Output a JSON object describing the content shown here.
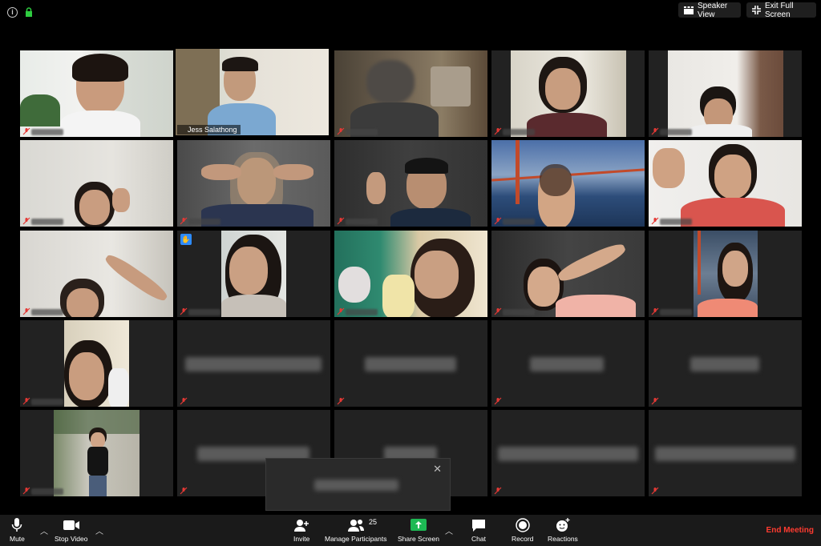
{
  "topbar": {
    "speaker_view_label": "Speaker View",
    "exit_fullscreen_label": "Exit Full Screen"
  },
  "participants": {
    "active_speaker_name": "Jess Salathong"
  },
  "toolbar": {
    "mute_label": "Mute",
    "stop_video_label": "Stop Video",
    "invite_label": "Invite",
    "manage_participants_label": "Manage Participants",
    "participant_count": "25",
    "share_screen_label": "Share Screen",
    "chat_label": "Chat",
    "record_label": "Record",
    "reactions_label": "Reactions",
    "end_meeting_label": "End Meeting"
  },
  "colors": {
    "active_speaker_border": "#d9e26d",
    "share_screen_green": "#1db954",
    "end_meeting_red": "#ff3b30",
    "raise_hand_blue": "#2d8cff"
  },
  "icons": [
    "info-icon",
    "lock-icon",
    "speaker-view-icon",
    "exit-fullscreen-icon",
    "mic-off-icon",
    "raise-hand-icon",
    "microphone-icon",
    "video-camera-icon",
    "invite-icon",
    "participants-icon",
    "share-screen-icon",
    "chat-icon",
    "record-icon",
    "reactions-icon",
    "close-icon",
    "caret-up-icon"
  ]
}
